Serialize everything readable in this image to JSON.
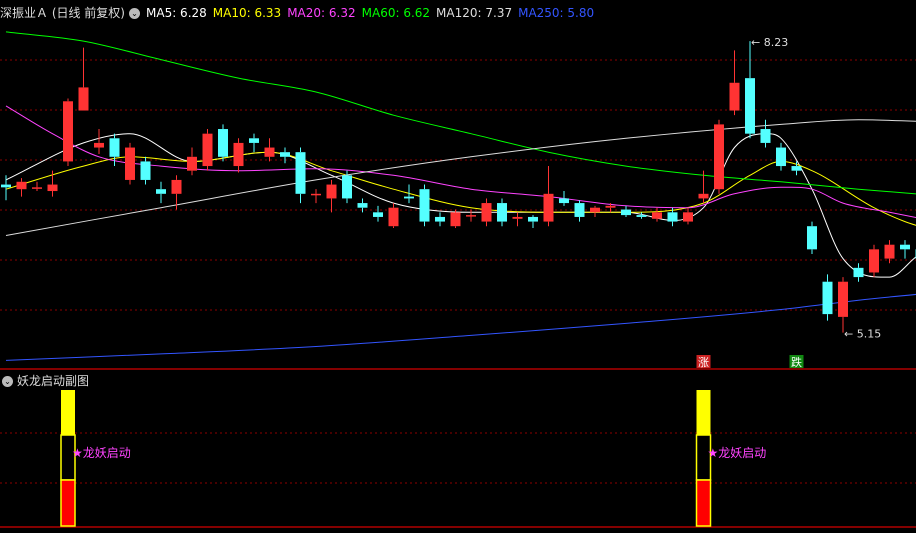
{
  "header": {
    "stock_title": "深振业Ａ (日线 前复权)",
    "ma_labels": [
      {
        "text": "MA5: 6.28",
        "color": "#ffffff"
      },
      {
        "text": "MA10: 6.33",
        "color": "#ffff00"
      },
      {
        "text": "MA20: 6.32",
        "color": "#ff44ff"
      },
      {
        "text": "MA60: 6.62",
        "color": "#00ff00"
      },
      {
        "text": "MA120: 7.37",
        "color": "#dddddd"
      },
      {
        "text": "MA250: 5.80",
        "color": "#3355ff"
      }
    ]
  },
  "subchart": {
    "title": "妖龙启动副图",
    "signal_label": "龙妖启动"
  },
  "colors": {
    "up": "#ff3333",
    "down": "#54ffff",
    "grid": "#8b0000"
  },
  "chart_data": {
    "type": "candlestick",
    "ylim": [
      4.8,
      8.55
    ],
    "max_label": "8.23",
    "min_label": "5.15",
    "markers": [
      {
        "text": "涨",
        "index": 45,
        "bg": "#cc2222"
      },
      {
        "text": "跌",
        "index": 51,
        "bg": "#118811"
      }
    ],
    "signals": [
      4,
      45
    ],
    "candles": [
      [
        6.75,
        6.72,
        6.85,
        6.58
      ],
      [
        6.7,
        6.78,
        6.82,
        6.62
      ],
      [
        6.72,
        6.72,
        6.78,
        6.68
      ],
      [
        6.68,
        6.75,
        6.9,
        6.62
      ],
      [
        7.0,
        7.65,
        7.68,
        6.95
      ],
      [
        7.55,
        7.8,
        8.23,
        7.55
      ],
      [
        7.15,
        7.2,
        7.35,
        7.08
      ],
      [
        7.25,
        7.05,
        7.3,
        6.95
      ],
      [
        6.8,
        7.15,
        7.2,
        6.75
      ],
      [
        7.0,
        6.8,
        7.05,
        6.75
      ],
      [
        6.7,
        6.65,
        6.78,
        6.55
      ],
      [
        6.65,
        6.8,
        6.85,
        6.48
      ],
      [
        6.9,
        7.05,
        7.15,
        6.85
      ],
      [
        6.95,
        7.3,
        7.35,
        6.9
      ],
      [
        7.35,
        7.05,
        7.4,
        7.0
      ],
      [
        6.95,
        7.2,
        7.25,
        6.88
      ],
      [
        7.25,
        7.2,
        7.3,
        7.1
      ],
      [
        7.05,
        7.15,
        7.25,
        7.0
      ],
      [
        7.1,
        7.05,
        7.15,
        6.98
      ],
      [
        7.1,
        6.65,
        7.15,
        6.55
      ],
      [
        6.65,
        6.65,
        6.7,
        6.55
      ],
      [
        6.6,
        6.75,
        6.8,
        6.45
      ],
      [
        6.85,
        6.6,
        6.9,
        6.55
      ],
      [
        6.55,
        6.5,
        6.6,
        6.45
      ],
      [
        6.45,
        6.4,
        6.52,
        6.35
      ],
      [
        6.3,
        6.5,
        6.55,
        6.28
      ],
      [
        6.62,
        6.6,
        6.75,
        6.55
      ],
      [
        6.7,
        6.35,
        6.75,
        6.3
      ],
      [
        6.4,
        6.35,
        6.45,
        6.3
      ],
      [
        6.3,
        6.45,
        6.48,
        6.28
      ],
      [
        6.42,
        6.42,
        6.48,
        6.35
      ],
      [
        6.35,
        6.55,
        6.6,
        6.3
      ],
      [
        6.55,
        6.35,
        6.6,
        6.3
      ],
      [
        6.38,
        6.4,
        6.45,
        6.3
      ],
      [
        6.4,
        6.35,
        6.42,
        6.28
      ],
      [
        6.35,
        6.65,
        6.95,
        6.3
      ],
      [
        6.6,
        6.55,
        6.68,
        6.52
      ],
      [
        6.55,
        6.4,
        6.58,
        6.35
      ],
      [
        6.45,
        6.5,
        6.52,
        6.4
      ],
      [
        6.5,
        6.52,
        6.55,
        6.45
      ],
      [
        6.48,
        6.42,
        6.52,
        6.4
      ],
      [
        6.42,
        6.4,
        6.45,
        6.38
      ],
      [
        6.38,
        6.45,
        6.5,
        6.35
      ],
      [
        6.45,
        6.35,
        6.5,
        6.3
      ],
      [
        6.35,
        6.45,
        6.5,
        6.32
      ],
      [
        6.6,
        6.65,
        6.9,
        6.55
      ],
      [
        6.7,
        7.4,
        7.45,
        6.65
      ],
      [
        7.55,
        7.85,
        8.2,
        7.5
      ],
      [
        7.9,
        7.3,
        8.3,
        7.25
      ],
      [
        7.35,
        7.2,
        7.45,
        7.15
      ],
      [
        7.15,
        6.95,
        7.2,
        6.9
      ],
      [
        6.95,
        6.9,
        7.0,
        6.85
      ],
      [
        6.3,
        6.05,
        6.35,
        6.0
      ],
      [
        5.7,
        5.35,
        5.78,
        5.28
      ],
      [
        5.32,
        5.7,
        5.75,
        5.15
      ],
      [
        5.85,
        5.75,
        5.9,
        5.7
      ],
      [
        5.8,
        6.05,
        6.1,
        5.75
      ],
      [
        5.95,
        6.1,
        6.15,
        5.9
      ],
      [
        6.1,
        6.05,
        6.15,
        5.95
      ],
      [
        6.05,
        5.95,
        6.1,
        5.85
      ],
      [
        5.95,
        5.95,
        6.0,
        5.9
      ],
      [
        5.95,
        6.15,
        6.2,
        5.92
      ]
    ],
    "ma_series": [
      {
        "label": "MA5",
        "color": "#ffffff",
        "points": [
          [
            0,
            6.8
          ],
          [
            5,
            7.2
          ],
          [
            8,
            7.3
          ],
          [
            12,
            7.0
          ],
          [
            17,
            7.1
          ],
          [
            21,
            6.85
          ],
          [
            25,
            6.55
          ],
          [
            30,
            6.45
          ],
          [
            35,
            6.45
          ],
          [
            40,
            6.45
          ],
          [
            45,
            6.5
          ],
          [
            47,
            7.15
          ],
          [
            49,
            7.3
          ],
          [
            50,
            7.25
          ],
          [
            52,
            6.7
          ],
          [
            54,
            5.95
          ],
          [
            57,
            5.75
          ],
          [
            59,
            6.0
          ],
          [
            61,
            6.05
          ]
        ]
      },
      {
        "label": "MA10",
        "color": "#ffff00",
        "points": [
          [
            0,
            6.7
          ],
          [
            5,
            6.95
          ],
          [
            8,
            7.05
          ],
          [
            12,
            7.0
          ],
          [
            17,
            7.1
          ],
          [
            21,
            6.9
          ],
          [
            25,
            6.7
          ],
          [
            30,
            6.5
          ],
          [
            35,
            6.45
          ],
          [
            40,
            6.45
          ],
          [
            45,
            6.55
          ],
          [
            48,
            6.85
          ],
          [
            50,
            7.0
          ],
          [
            52,
            6.9
          ],
          [
            56,
            6.5
          ],
          [
            58,
            6.35
          ],
          [
            61,
            6.2
          ]
        ]
      },
      {
        "label": "MA20",
        "color": "#ff44ff",
        "points": [
          [
            0,
            7.6
          ],
          [
            3,
            7.3
          ],
          [
            6,
            7.05
          ],
          [
            10,
            6.95
          ],
          [
            15,
            6.9
          ],
          [
            20,
            6.92
          ],
          [
            25,
            6.85
          ],
          [
            30,
            6.7
          ],
          [
            35,
            6.62
          ],
          [
            40,
            6.52
          ],
          [
            44,
            6.5
          ],
          [
            47,
            6.65
          ],
          [
            50,
            6.72
          ],
          [
            52,
            6.7
          ],
          [
            54,
            6.55
          ],
          [
            57,
            6.45
          ],
          [
            61,
            6.32
          ]
        ]
      },
      {
        "label": "MA60",
        "color": "#00ff00",
        "points": [
          [
            0,
            8.4
          ],
          [
            5,
            8.3
          ],
          [
            10,
            8.1
          ],
          [
            15,
            7.9
          ],
          [
            20,
            7.75
          ],
          [
            25,
            7.5
          ],
          [
            30,
            7.3
          ],
          [
            35,
            7.1
          ],
          [
            40,
            6.95
          ],
          [
            45,
            6.85
          ],
          [
            50,
            6.78
          ],
          [
            55,
            6.7
          ],
          [
            61,
            6.62
          ]
        ]
      },
      {
        "label": "MA120",
        "color": "#dddddd",
        "points": [
          [
            0,
            6.2
          ],
          [
            10,
            6.5
          ],
          [
            20,
            6.8
          ],
          [
            30,
            7.05
          ],
          [
            40,
            7.25
          ],
          [
            50,
            7.4
          ],
          [
            55,
            7.45
          ],
          [
            61,
            7.42
          ]
        ]
      },
      {
        "label": "MA250",
        "color": "#3355ff",
        "points": [
          [
            0,
            4.85
          ],
          [
            10,
            4.92
          ],
          [
            20,
            5.0
          ],
          [
            30,
            5.12
          ],
          [
            40,
            5.25
          ],
          [
            50,
            5.4
          ],
          [
            55,
            5.5
          ],
          [
            61,
            5.6
          ]
        ]
      }
    ]
  }
}
